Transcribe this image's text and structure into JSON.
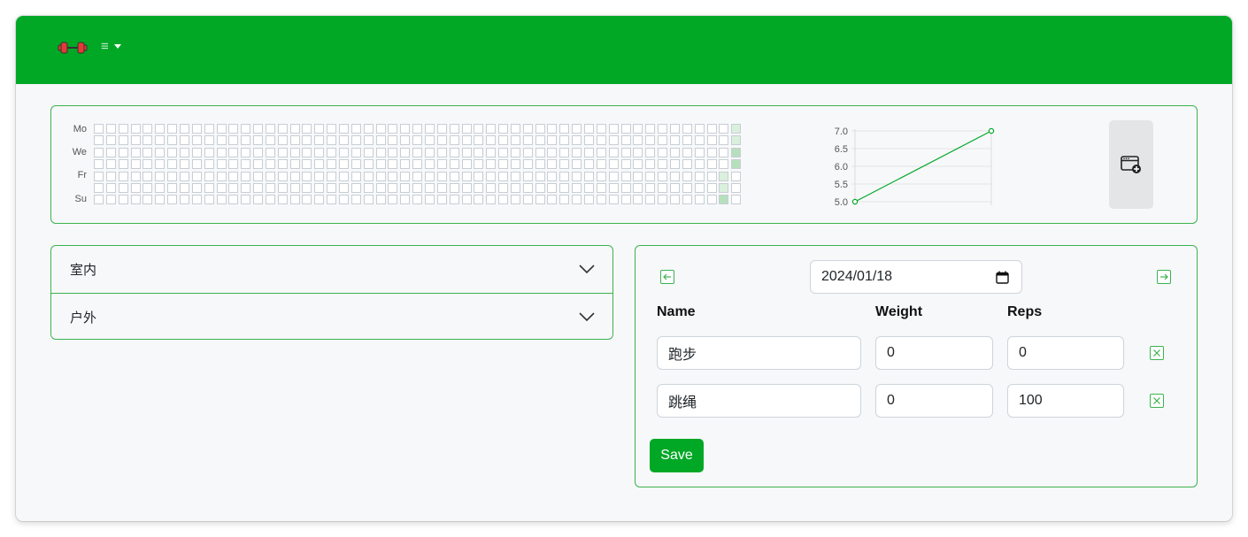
{
  "colors": {
    "brand": "#01a826",
    "border": "#3cb34f",
    "cell_empty": "#ffffff",
    "cell_low": "#d9f0dd",
    "cell_mid": "#b6e0bd",
    "cell_high": "#9cd4a6"
  },
  "navbar": {
    "logo_icon": "dumbbell-icon",
    "menu_icon": "hamburger-icon"
  },
  "heatmap": {
    "day_labels": [
      "Mo",
      "We",
      "Fr",
      "Su"
    ],
    "weeks": 53,
    "active": [
      {
        "week": 51,
        "day": 6,
        "level": "mid"
      },
      {
        "week": 51,
        "day": 4,
        "level": "low"
      },
      {
        "week": 51,
        "day": 5,
        "level": "low"
      },
      {
        "week": 52,
        "day": 0,
        "level": "low"
      },
      {
        "week": 52,
        "day": 1,
        "level": "low"
      },
      {
        "week": 52,
        "day": 2,
        "level": "mid"
      },
      {
        "week": 52,
        "day": 3,
        "level": "mid"
      }
    ]
  },
  "chart_data": {
    "type": "line",
    "x": [
      0,
      1
    ],
    "series": [
      {
        "values": [
          5.0,
          7.0
        ]
      }
    ],
    "y_ticks": [
      "7.0",
      "6.5",
      "6.0",
      "5.5",
      "5.0"
    ],
    "ylim": [
      5.0,
      7.0
    ],
    "grid": true
  },
  "add_button": {
    "icon": "add-card-icon"
  },
  "categories": [
    {
      "label": "室内"
    },
    {
      "label": "户外"
    }
  ],
  "workout": {
    "date": "2024/01/18",
    "headers": {
      "name": "Name",
      "weight": "Weight",
      "reps": "Reps"
    },
    "rows": [
      {
        "name": "跑步",
        "weight": "0",
        "reps": "0"
      },
      {
        "name": "跳绳",
        "weight": "0",
        "reps": "100"
      }
    ],
    "save_label": "Save"
  }
}
